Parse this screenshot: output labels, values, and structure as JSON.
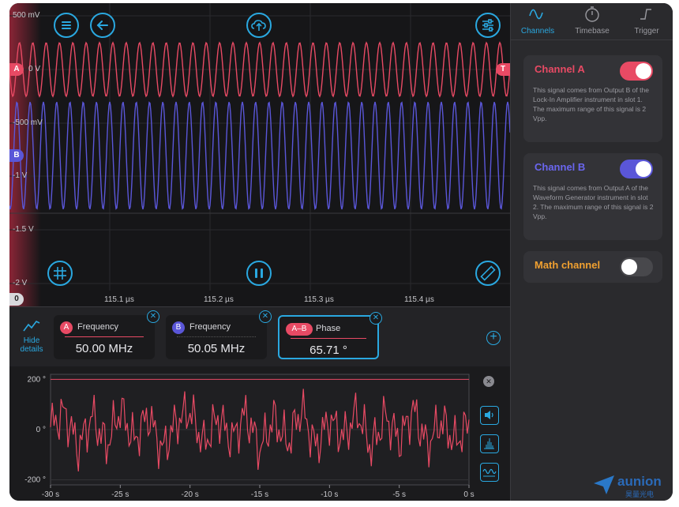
{
  "scope": {
    "y_labels": [
      "500 mV",
      "0 V",
      "-500 mV",
      "-1 V",
      "-1.5 V",
      "-2 V"
    ],
    "x_labels": [
      "115.1 µs",
      "115.2 µs",
      "115.3 µs",
      "115.4 µs"
    ],
    "channel_a_marker": "A",
    "channel_b_marker": "B",
    "trigger_marker": "T",
    "ground_marker": "0",
    "channel_a_color": "#e84a64",
    "channel_b_color": "#5a56d8",
    "buttons": [
      "menu-icon",
      "back-arrow-icon",
      "cloud-upload-icon",
      "sliders-icon",
      "grid-icon",
      "pause-icon",
      "ruler-icon"
    ]
  },
  "details": {
    "toggle_label_1": "Hide",
    "toggle_label_2": "details",
    "measurements": [
      {
        "badge": "A",
        "name": "Frequency",
        "value": "50.00 MHz",
        "color": "#e84a64"
      },
      {
        "badge": "B",
        "name": "Frequency",
        "value": "50.05 MHz",
        "color": "#5a56d8"
      },
      {
        "badge": "A–B",
        "name": "Phase",
        "value": "65.71 °",
        "color": "#e84a64"
      }
    ]
  },
  "chart_data": {
    "type": "line",
    "title": "",
    "xlabel": "",
    "ylabel": "",
    "x_ticks": [
      "-30 s",
      "-25 s",
      "-20 s",
      "-15 s",
      "-10 s",
      "-5 s",
      "0 s"
    ],
    "y_ticks": [
      "200 °",
      "0 °",
      "-200 °"
    ],
    "xlim": [
      -30,
      0
    ],
    "ylim": [
      -220,
      220
    ],
    "series": [
      {
        "color": "#e84a64",
        "x": [
          -30,
          -29,
          -28,
          -27,
          -26,
          -25,
          -24,
          -23,
          -22,
          -21,
          -20,
          -19,
          -18,
          -17,
          -16,
          -15,
          -14,
          -13,
          -12,
          -11,
          -10,
          -9,
          -8,
          -7,
          -6,
          -5,
          -4,
          -3,
          -2,
          -1,
          0
        ],
        "values": [
          20,
          140,
          -150,
          110,
          -130,
          160,
          -90,
          120,
          -170,
          60,
          150,
          -120,
          100,
          -80,
          130,
          -160,
          90,
          -110,
          170,
          -140,
          80,
          -60,
          140,
          -150,
          110,
          -90,
          160,
          -130,
          70,
          -100,
          40
        ]
      }
    ],
    "grid": true
  },
  "sidebar": {
    "tabs": [
      {
        "label": "Channels",
        "icon": "sine-wave-icon"
      },
      {
        "label": "Timebase",
        "icon": "stopwatch-icon"
      },
      {
        "label": "Trigger",
        "icon": "step-icon"
      }
    ],
    "channel_a": {
      "title": "Channel A",
      "description": "This signal comes from Output B of the Lock-In Amplifier instrument in slot 1. The maximum range of this signal is 2 Vpp.",
      "enabled": true,
      "color": "#e84a64"
    },
    "channel_b": {
      "title": "Channel B",
      "description": "This signal comes from Output A of the Waveform Generator instrument in slot 2. The maximum range of this signal is 2 Vpp.",
      "enabled": true,
      "color": "#5a56d8"
    },
    "math_channel": {
      "title": "Math channel",
      "enabled": false,
      "color": "#f0a030"
    }
  },
  "logo": {
    "text": "aunion",
    "subtext": "昊量光电"
  }
}
